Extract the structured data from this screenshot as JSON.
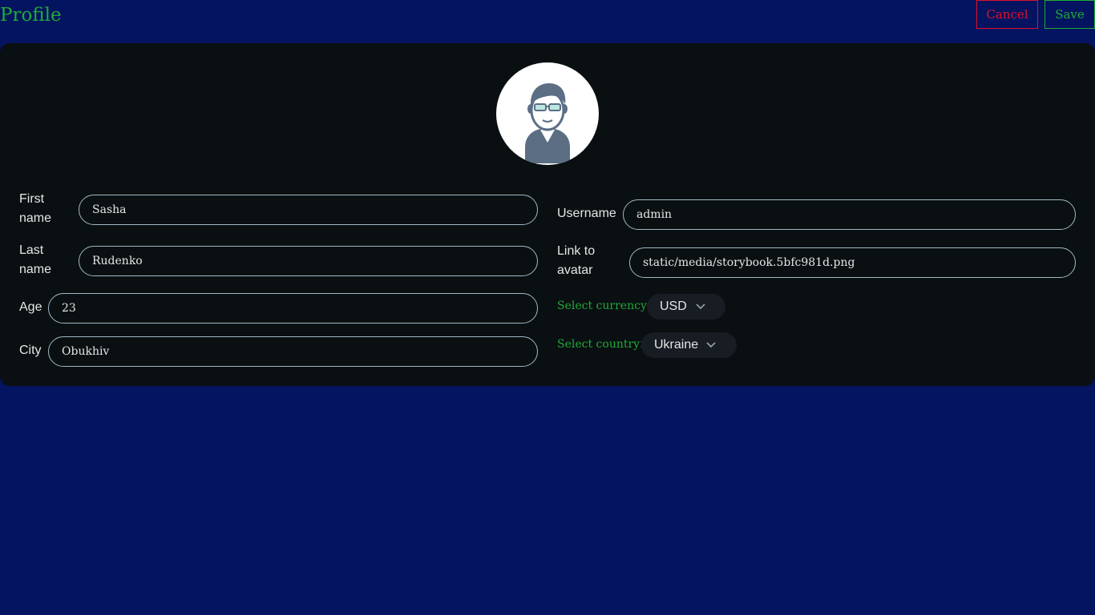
{
  "header": {
    "title": "Profile",
    "cancel_label": "Cancel",
    "save_label": "Save"
  },
  "avatar": {
    "alt": "avatar",
    "icon": "user-avatar-icon"
  },
  "form": {
    "first_name": {
      "label": "First name",
      "value": "Sasha"
    },
    "last_name": {
      "label": "Last name",
      "value": "Rudenko"
    },
    "age": {
      "label": "Age",
      "value": "23"
    },
    "city": {
      "label": "City",
      "value": "Obukhiv"
    },
    "username": {
      "label": "Username",
      "value": "admin"
    },
    "avatar_link": {
      "label": "Link to avatar",
      "value": "static/media/storybook.5bfc981d.png"
    },
    "currency": {
      "label": "Select currency>",
      "selected": "USD"
    },
    "country": {
      "label": "Select country>",
      "selected": "Ukraine"
    }
  },
  "colors": {
    "page_background": "#041460",
    "card_background": "#0a0f12",
    "accent_green": "#1fab36",
    "cancel_red": "#e0102a",
    "input_border": "#9fb9c4"
  }
}
